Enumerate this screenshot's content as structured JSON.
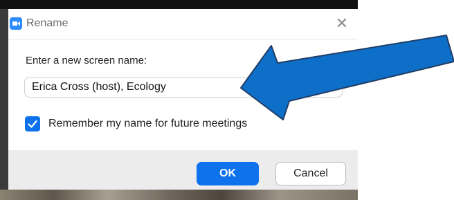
{
  "dialog": {
    "title": "Rename",
    "close_icon": "close-icon",
    "app_icon": "zoom-camera-icon",
    "prompt": "Enter a new screen name:",
    "name_value": "Erica Cross (host), Ecology",
    "remember_checked": true,
    "remember_label": "Remember my name for future meetings",
    "ok_label": "OK",
    "cancel_label": "Cancel"
  },
  "annotation": {
    "arrow_color": "#0e6fc9",
    "arrow_outline_color": "#1f3d66"
  },
  "colors": {
    "accent": "#0e72ed"
  }
}
